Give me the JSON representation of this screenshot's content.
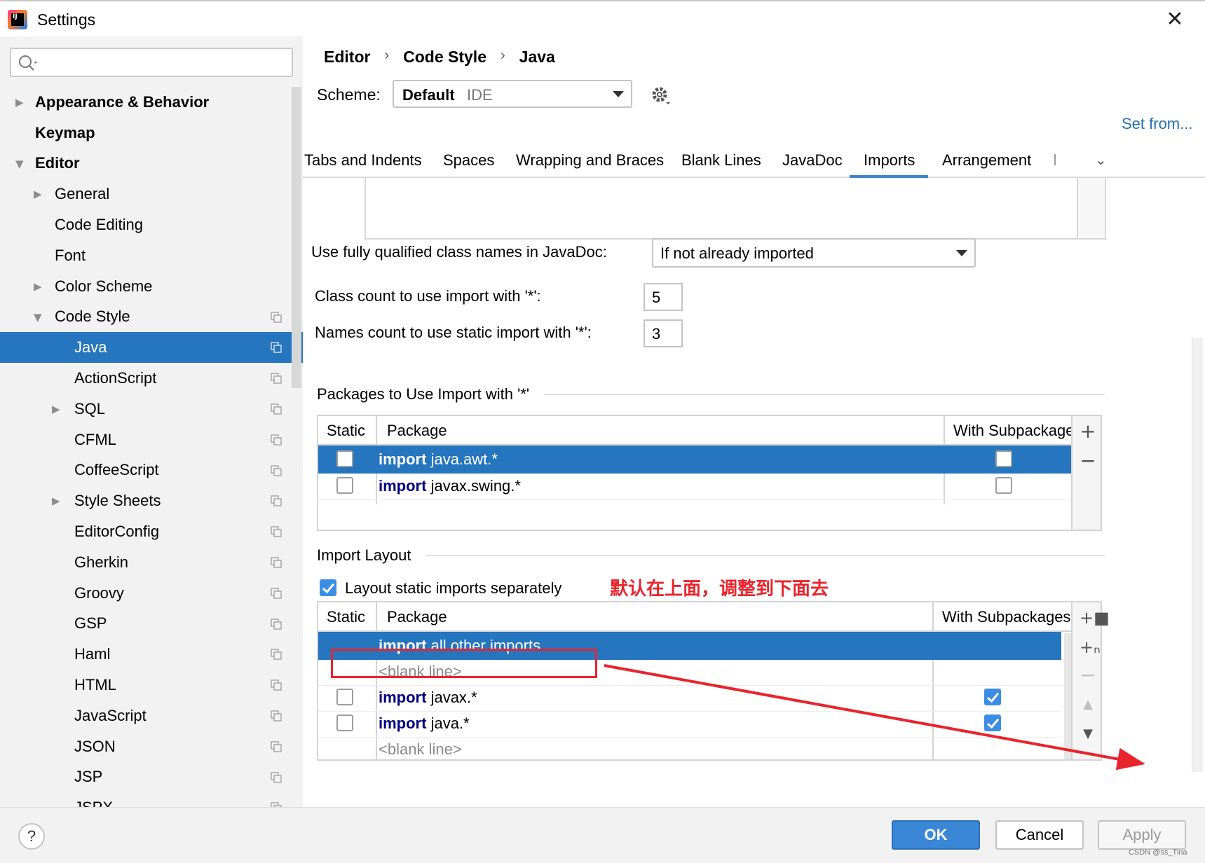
{
  "window": {
    "title": "Settings",
    "close_glyph": "✕"
  },
  "sidebar": {
    "search_placeholder": "",
    "items": [
      {
        "label": "Appearance & Behavior",
        "bold": true,
        "expandable": true,
        "expanded": false,
        "indent": 0
      },
      {
        "label": "Keymap",
        "bold": true,
        "expandable": false,
        "indent": 0
      },
      {
        "label": "Editor",
        "bold": true,
        "expandable": true,
        "expanded": true,
        "indent": 0
      },
      {
        "label": "General",
        "expandable": true,
        "expanded": false,
        "indent": 1
      },
      {
        "label": "Code Editing",
        "indent": 1
      },
      {
        "label": "Font",
        "indent": 1
      },
      {
        "label": "Color Scheme",
        "expandable": true,
        "expanded": false,
        "indent": 1
      },
      {
        "label": "Code Style",
        "expandable": true,
        "expanded": true,
        "indent": 1,
        "copy_icon": true
      },
      {
        "label": "Java",
        "indent": 2,
        "selected": true,
        "copy_icon": true
      },
      {
        "label": "ActionScript",
        "indent": 2,
        "copy_icon": true
      },
      {
        "label": "SQL",
        "expandable": true,
        "expanded": false,
        "indent": 2,
        "copy_icon": true
      },
      {
        "label": "CFML",
        "indent": 2,
        "copy_icon": true
      },
      {
        "label": "CoffeeScript",
        "indent": 2,
        "copy_icon": true
      },
      {
        "label": "Style Sheets",
        "expandable": true,
        "expanded": false,
        "indent": 2,
        "copy_icon": true
      },
      {
        "label": "EditorConfig",
        "indent": 2,
        "copy_icon": true
      },
      {
        "label": "Gherkin",
        "indent": 2,
        "copy_icon": true
      },
      {
        "label": "Groovy",
        "indent": 2,
        "copy_icon": true
      },
      {
        "label": "GSP",
        "indent": 2,
        "copy_icon": true
      },
      {
        "label": "Haml",
        "indent": 2,
        "copy_icon": true
      },
      {
        "label": "HTML",
        "indent": 2,
        "copy_icon": true
      },
      {
        "label": "JavaScript",
        "indent": 2,
        "copy_icon": true
      },
      {
        "label": "JSON",
        "indent": 2,
        "copy_icon": true
      },
      {
        "label": "JSP",
        "indent": 2,
        "copy_icon": true
      },
      {
        "label": "JSPX",
        "indent": 2,
        "copy_icon": true
      }
    ]
  },
  "breadcrumb": [
    "Editor",
    "Code Style",
    "Java"
  ],
  "breadcrumb_sep": "›",
  "scheme": {
    "label": "Scheme:",
    "value": "Default",
    "sub": "IDE"
  },
  "set_from": "Set from...",
  "tabs": {
    "items": [
      "Tabs and Indents",
      "Spaces",
      "Wrapping and Braces",
      "Blank Lines",
      "JavaDoc",
      "Imports",
      "Arrangement"
    ],
    "active": "Imports"
  },
  "javadoc_fq": {
    "label": "Use fully qualified class names in JavaDoc:",
    "value": "If not already imported"
  },
  "class_count": {
    "label": "Class count to use import with '*':",
    "value": "5"
  },
  "names_count": {
    "label": "Names count to use static import with '*':",
    "value": "3"
  },
  "packages_star": {
    "title": "Packages to Use Import with '*'",
    "headers": {
      "static": "Static",
      "package": "Package",
      "subpackages": "With Subpackages"
    },
    "rows": [
      {
        "kw": "import",
        "pkg": "java.awt.*",
        "static": false,
        "sub": false,
        "selected": true
      },
      {
        "kw": "import",
        "pkg": "javax.swing.*",
        "static": false,
        "sub": false,
        "selected": false
      }
    ]
  },
  "import_layout": {
    "title": "Import Layout",
    "separate_label": "Layout static imports separately",
    "separate_checked": true,
    "headers": {
      "static": "Static",
      "package": "Package",
      "subpackages": "With Subpackages"
    },
    "rows": [
      {
        "kind": "import",
        "kw": "import",
        "pkg": "all other imports",
        "selected": true,
        "has_cb": false,
        "sub": null
      },
      {
        "kind": "blank",
        "text": "<blank line>"
      },
      {
        "kind": "import",
        "kw": "import",
        "pkg": "javax.*",
        "selected": false,
        "has_cb": true,
        "static": false,
        "sub": true
      },
      {
        "kind": "import",
        "kw": "import",
        "pkg": "java.*",
        "selected": false,
        "has_cb": true,
        "static": false,
        "sub": true
      },
      {
        "kind": "blank",
        "text": "<blank line>"
      }
    ]
  },
  "annotation": "默认在上面，调整到下面去",
  "footer": {
    "help": "?",
    "ok": "OK",
    "cancel": "Cancel",
    "apply": "Apply",
    "watermark": "CSDN @ss_Tina"
  },
  "colors": {
    "selection": "#2675bf",
    "ok_button": "#3a87d8",
    "annotation_red": "#e8242c",
    "link": "#2470b3",
    "keyword": "#000080"
  }
}
